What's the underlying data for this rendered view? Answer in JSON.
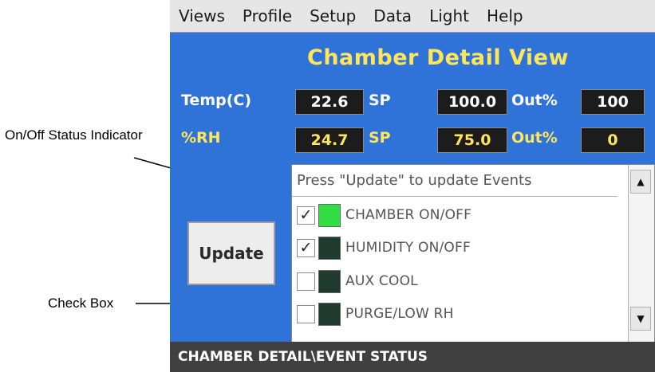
{
  "annotations": {
    "status_indicator": "On/Off Status Indicator",
    "check_box": "Check Box"
  },
  "menu": [
    "Views",
    "Profile",
    "Setup",
    "Data",
    "Light",
    "Help"
  ],
  "title": "Chamber Detail View",
  "temp_row": {
    "label": "Temp(C)",
    "value": "22.6",
    "sp_label": "SP",
    "sp_value": "100.0",
    "out_label": "Out%",
    "out_value": "100"
  },
  "rh_row": {
    "label": "%RH",
    "value": "24.7",
    "sp_label": "SP",
    "sp_value": "75.0",
    "out_label": "Out%",
    "out_value": "0"
  },
  "events": {
    "header": "Press \"Update\" to update Events",
    "items": [
      {
        "label": "CHAMBER ON/OFF",
        "checked": true,
        "indicator": "#33dd44"
      },
      {
        "label": "HUMIDITY ON/OFF",
        "checked": true,
        "indicator": "#1f3a2e"
      },
      {
        "label": "AUX COOL",
        "checked": false,
        "indicator": "#1f3a2e"
      },
      {
        "label": "PURGE/LOW RH",
        "checked": false,
        "indicator": "#1f3a2e"
      }
    ]
  },
  "update_button": "Update",
  "status_bar": "CHAMBER DETAIL\\EVENT STATUS",
  "colors": {
    "screen_bg": "#2f73d9",
    "title": "#ffe55a",
    "indicator_on": "#33dd44",
    "indicator_off": "#1f3a2e"
  }
}
